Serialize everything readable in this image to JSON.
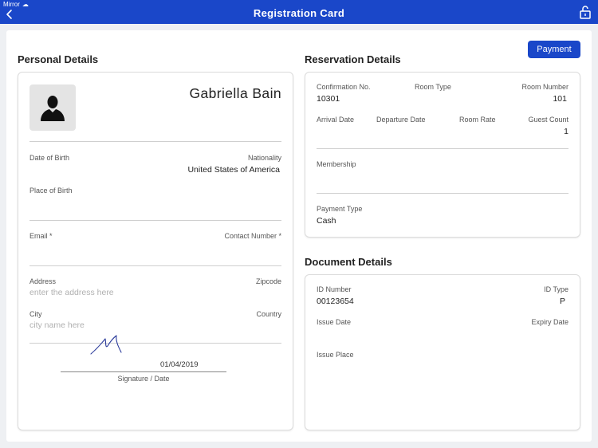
{
  "status_bar": {
    "carrier": "Mirror"
  },
  "header": {
    "title": "Registration Card"
  },
  "icons": {
    "back": "chevron-left-icon",
    "lock": "unlock-icon",
    "cloud": "cloud-icon",
    "avatar": "person-silhouette-icon"
  },
  "colors": {
    "accent": "#1a47c9"
  },
  "payment_button": "Payment",
  "personal": {
    "title": "Personal Details",
    "name": "Gabriella  Bain",
    "dob_label": "Date of Birth",
    "nationality_label": "Nationality",
    "nationality_value": "United States of America",
    "place_of_birth_label": "Place of Birth",
    "email_label": "Email *",
    "contact_label": "Contact Number *",
    "address_label": "Address",
    "address_placeholder": "enter the address here",
    "zipcode_label": "Zipcode",
    "city_label": "City",
    "city_placeholder": "city name here",
    "country_label": "Country",
    "signature_date": "01/04/2019",
    "signature_label": "Signature / Date"
  },
  "reservation": {
    "title": "Reservation Details",
    "confirmation_label": "Confirmation No.",
    "confirmation_value": "10301",
    "room_type_label": "Room Type",
    "room_number_label": "Room Number",
    "room_number_value": "101",
    "arrival_label": "Arrival Date",
    "departure_label": "Departure Date",
    "room_rate_label": "Room Rate",
    "guest_count_label": "Guest Count",
    "guest_count_value": "1",
    "membership_label": "Membership",
    "payment_type_label": "Payment Type",
    "payment_type_value": "Cash"
  },
  "document": {
    "title": "Document Details",
    "id_number_label": "ID Number",
    "id_number_value": "00123654",
    "id_type_label": "ID Type",
    "id_type_value": "P",
    "issue_date_label": "Issue Date",
    "expiry_date_label": "Expiry Date",
    "issue_place_label": "Issue Place"
  }
}
